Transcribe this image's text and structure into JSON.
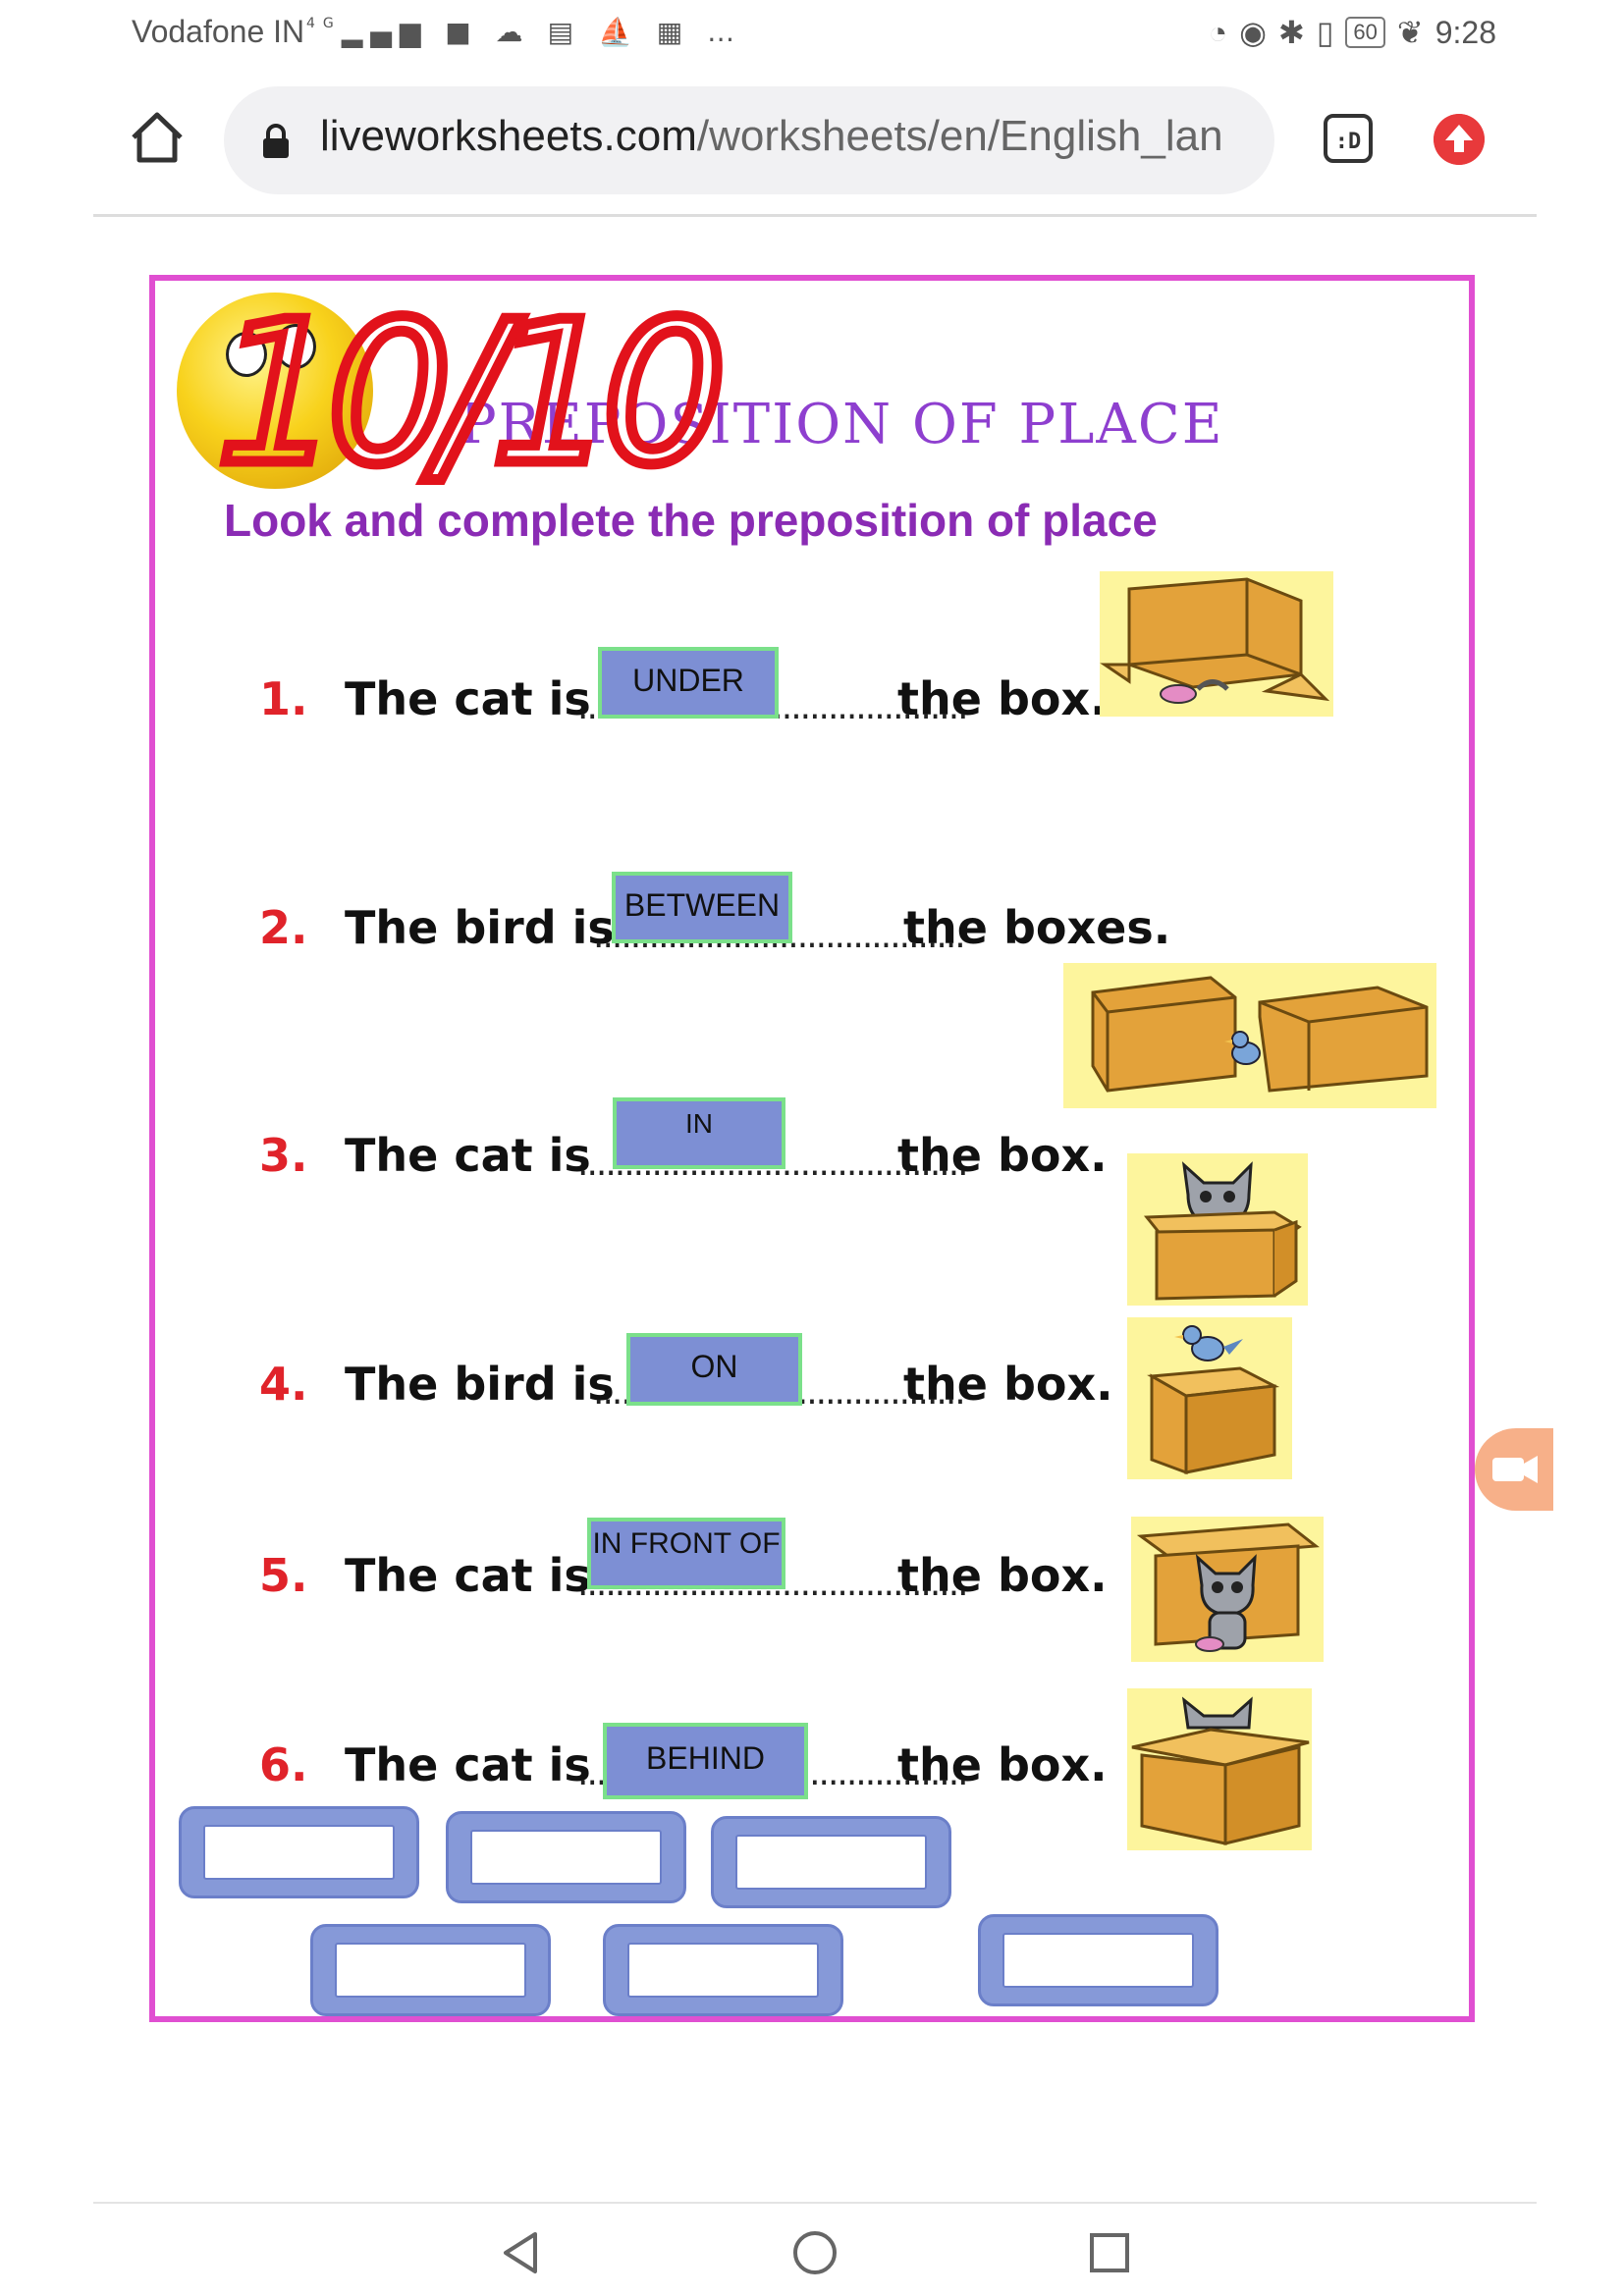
{
  "status_bar": {
    "carrier": "Vodafone IN",
    "network": "4G",
    "battery": "60",
    "time": "9:28"
  },
  "browser": {
    "url_domain": "liveworksheets.com",
    "url_path": "/worksheets/en/English_lan",
    "tabs_label": ":D"
  },
  "worksheet": {
    "score": "10/10",
    "title": "PREPOSITION OF PLACE",
    "instruction": "Look and complete the preposition of place",
    "questions": [
      {
        "num": "1.",
        "stem": "The cat is",
        "answer": "UNDER",
        "tail": "the box."
      },
      {
        "num": "2.",
        "stem": "The bird is",
        "answer": "BETWEEN",
        "tail": "the boxes."
      },
      {
        "num": "3.",
        "stem": "The cat is",
        "answer": "IN",
        "tail": "the box."
      },
      {
        "num": "4.",
        "stem": "The bird is",
        "answer": "ON",
        "tail": "the box."
      },
      {
        "num": "5.",
        "stem": "The cat is",
        "answer": "IN FRONT OF",
        "tail": "the box."
      },
      {
        "num": "6.",
        "stem": "The cat is",
        "answer": "BEHIND",
        "tail": "the box."
      }
    ],
    "answer_bank_slots": 6
  },
  "colors": {
    "sheet_border": "#e04fd1",
    "title": "#8e3fcf",
    "number": "#e0232a",
    "answer_fill": "#7d8fd4",
    "answer_border": "#7be08a",
    "picture_bg": "#fdf59d",
    "box": "#e3a23a"
  },
  "icons": {
    "home": "home-icon",
    "lock": "lock-icon",
    "tabs": "tabs-icon",
    "update": "update-arrow-icon",
    "record": "record-video-icon",
    "nav_back": "back-triangle-icon",
    "nav_home": "home-circle-icon",
    "nav_recents": "recents-square-icon"
  }
}
